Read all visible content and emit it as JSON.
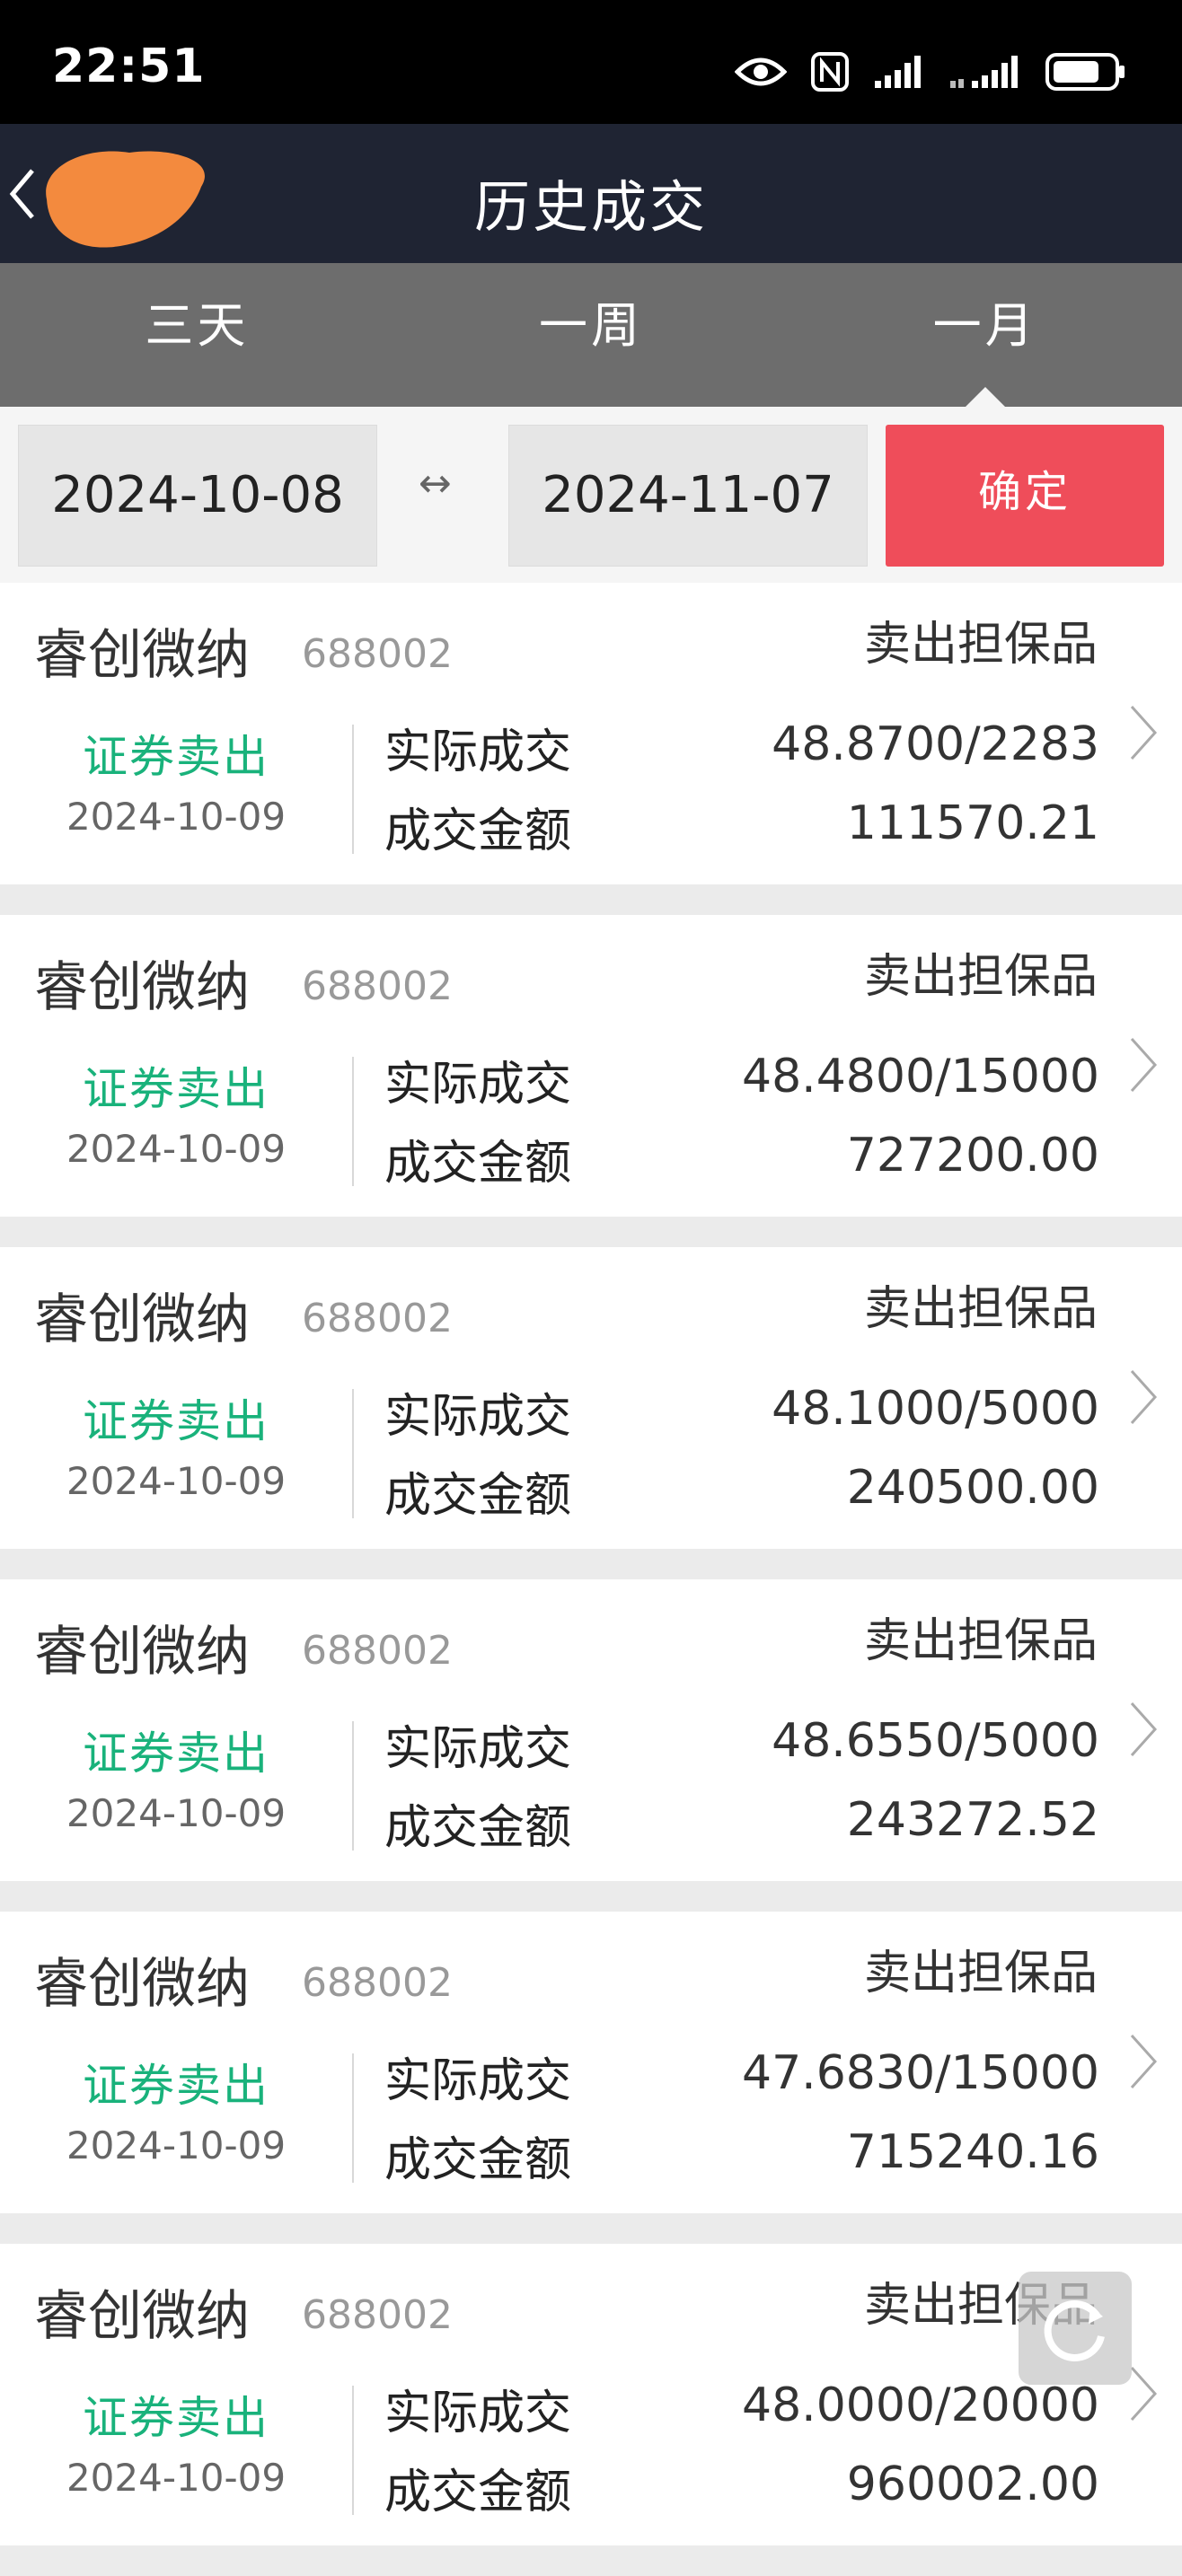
{
  "status_bar": {
    "time": "22:51",
    "icons": [
      "eye-icon",
      "nfc-icon",
      "signal-icon",
      "signal-4g-icon",
      "battery-icon"
    ]
  },
  "header": {
    "title": "历史成交",
    "back_icon": "chevron-left-icon"
  },
  "tabs": [
    {
      "label": "三天",
      "active": false
    },
    {
      "label": "一周",
      "active": false
    },
    {
      "label": "一月",
      "active": true
    }
  ],
  "date_range": {
    "start": "2024-10-08",
    "separator": "↔",
    "end": "2024-11-07",
    "confirm_label": "确定"
  },
  "labels": {
    "actual_trade": "实际成交",
    "trade_amount": "成交金额"
  },
  "colors": {
    "header_bg": "#1f2433",
    "tab_bg": "#6d6d6d",
    "confirm_bg": "#ef4d5a",
    "direction_green": "#19b27b"
  },
  "trades": [
    {
      "name": "睿创微纳",
      "code": "688002",
      "type": "卖出担保品",
      "direction": "证券卖出",
      "date": "2024-10-09",
      "actual": "48.8700/2283",
      "amount": "111570.21"
    },
    {
      "name": "睿创微纳",
      "code": "688002",
      "type": "卖出担保品",
      "direction": "证券卖出",
      "date": "2024-10-09",
      "actual": "48.4800/15000",
      "amount": "727200.00"
    },
    {
      "name": "睿创微纳",
      "code": "688002",
      "type": "卖出担保品",
      "direction": "证券卖出",
      "date": "2024-10-09",
      "actual": "48.1000/5000",
      "amount": "240500.00"
    },
    {
      "name": "睿创微纳",
      "code": "688002",
      "type": "卖出担保品",
      "direction": "证券卖出",
      "date": "2024-10-09",
      "actual": "48.6550/5000",
      "amount": "243272.52"
    },
    {
      "name": "睿创微纳",
      "code": "688002",
      "type": "卖出担保品",
      "direction": "证券卖出",
      "date": "2024-10-09",
      "actual": "47.6830/15000",
      "amount": "715240.16"
    },
    {
      "name": "睿创微纳",
      "code": "688002",
      "type": "卖出担保品",
      "direction": "证券卖出",
      "date": "2024-10-09",
      "actual": "48.0000/20000",
      "amount": "960002.00"
    }
  ]
}
